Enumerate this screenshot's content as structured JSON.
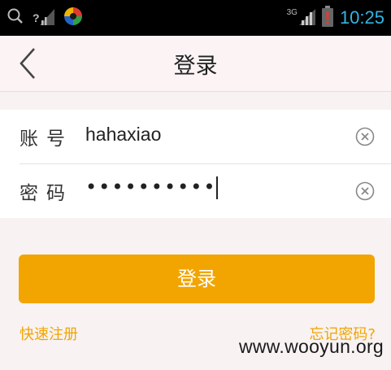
{
  "status_bar": {
    "time": "10:25",
    "network_type": "3G",
    "signal_unknown_mark": "?",
    "icons": [
      "search-icon",
      "signal-icon",
      "app-notification-icon",
      "signal-3g-icon",
      "battery-low-icon"
    ],
    "time_color": "#33b5e5"
  },
  "header": {
    "title": "登录",
    "back_icon": "chevron-left-icon"
  },
  "form": {
    "account": {
      "label": "账号",
      "value": "hahaxiao",
      "clear_icon": "clear-circle-icon"
    },
    "password": {
      "label": "密码",
      "value_masked": "••••••••••",
      "clear_icon": "clear-circle-icon"
    }
  },
  "actions": {
    "login_label": "登录",
    "register_label": "快速注册",
    "forgot_label": "忘记密码?"
  },
  "watermark": "www.wooyun.org",
  "colors": {
    "accent": "#f2a500",
    "page_bg": "#f8f2f3",
    "status_bar_bg": "#000000"
  }
}
